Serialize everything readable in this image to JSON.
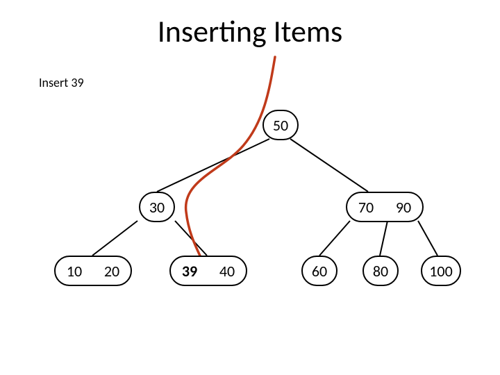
{
  "title": "Inserting Items",
  "annotation": "Insert 39",
  "tree": {
    "root": {
      "values": [
        "50"
      ]
    },
    "level2_left": {
      "values": [
        "30"
      ]
    },
    "level2_right": {
      "values": [
        "70",
        "90"
      ]
    },
    "leaf1": {
      "values": [
        "10",
        "20"
      ]
    },
    "leaf2": {
      "values": [
        "39",
        "40"
      ]
    },
    "leaf3": {
      "values": [
        "60"
      ]
    },
    "leaf4": {
      "values": [
        "80"
      ]
    },
    "leaf5": {
      "values": [
        "100"
      ]
    },
    "inserted_value": "39"
  },
  "arrow_color": "#c03a1a"
}
